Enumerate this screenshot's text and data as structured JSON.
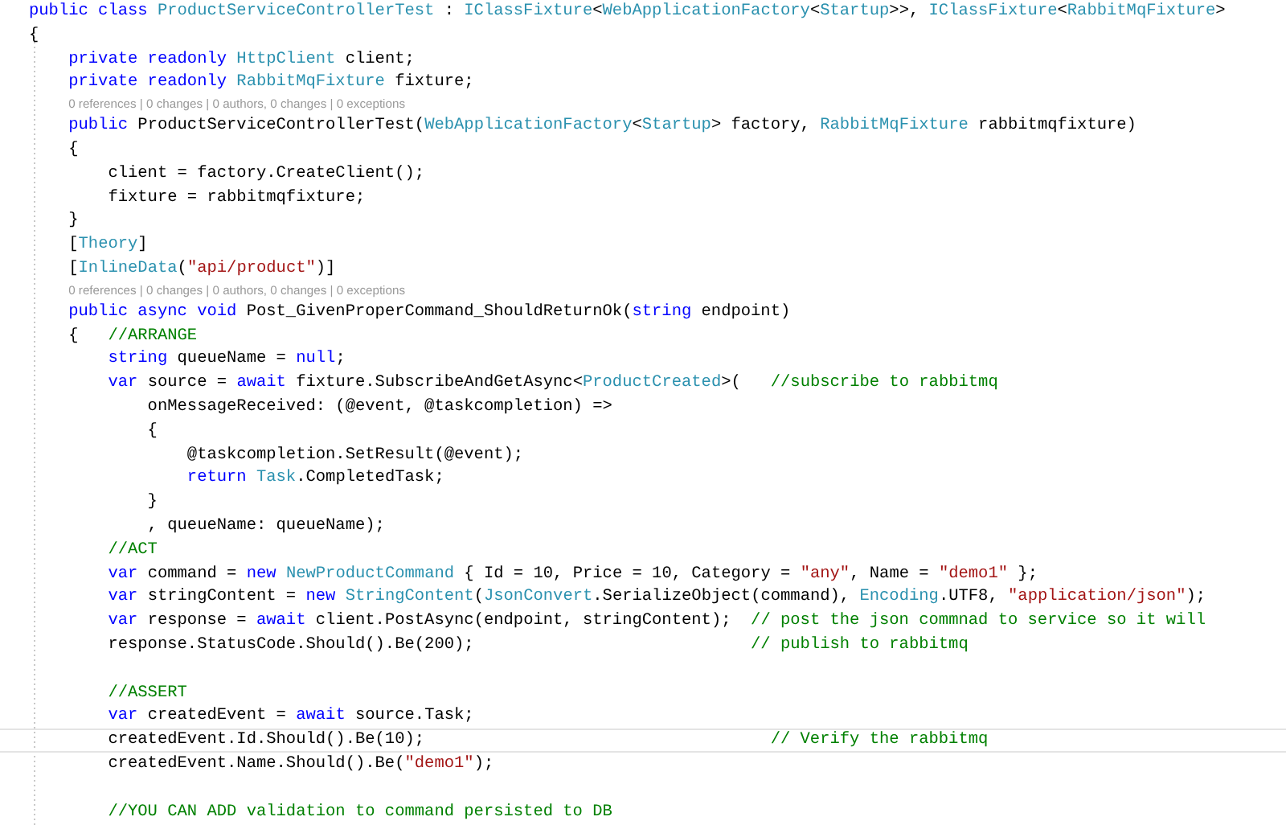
{
  "editor": {
    "lines": [
      {
        "kind": "code",
        "current": false,
        "tokens": [
          {
            "kind": "keyword",
            "text": "public class "
          },
          {
            "kind": "type",
            "text": "ProductServiceControllerTest"
          },
          {
            "kind": "plain",
            "text": " : "
          },
          {
            "kind": "type",
            "text": "IClassFixture"
          },
          {
            "kind": "plain",
            "text": "<"
          },
          {
            "kind": "type",
            "text": "WebApplicationFactory"
          },
          {
            "kind": "plain",
            "text": "<"
          },
          {
            "kind": "type",
            "text": "Startup"
          },
          {
            "kind": "plain",
            "text": ">>, "
          },
          {
            "kind": "type",
            "text": "IClassFixture"
          },
          {
            "kind": "plain",
            "text": "<"
          },
          {
            "kind": "type",
            "text": "RabbitMqFixture"
          },
          {
            "kind": "plain",
            "text": ">"
          }
        ]
      },
      {
        "kind": "code",
        "current": false,
        "tokens": [
          {
            "kind": "plain",
            "text": "{"
          }
        ]
      },
      {
        "kind": "code",
        "current": false,
        "tokens": [
          {
            "kind": "keyword",
            "text": "    private readonly "
          },
          {
            "kind": "type",
            "text": "HttpClient"
          },
          {
            "kind": "plain",
            "text": " client;"
          }
        ]
      },
      {
        "kind": "code",
        "current": false,
        "tokens": [
          {
            "kind": "keyword",
            "text": "    private readonly "
          },
          {
            "kind": "type",
            "text": "RabbitMqFixture"
          },
          {
            "kind": "plain",
            "text": " fixture;"
          }
        ]
      },
      {
        "kind": "codelens",
        "text": "0 references | 0 changes | 0 authors, 0 changes | 0 exceptions"
      },
      {
        "kind": "code",
        "current": false,
        "tokens": [
          {
            "kind": "keyword",
            "text": "    public "
          },
          {
            "kind": "plain",
            "text": "ProductServiceControllerTest("
          },
          {
            "kind": "type",
            "text": "WebApplicationFactory"
          },
          {
            "kind": "plain",
            "text": "<"
          },
          {
            "kind": "type",
            "text": "Startup"
          },
          {
            "kind": "plain",
            "text": "> factory, "
          },
          {
            "kind": "type",
            "text": "RabbitMqFixture"
          },
          {
            "kind": "plain",
            "text": " rabbitmqfixture)"
          }
        ]
      },
      {
        "kind": "code",
        "current": false,
        "tokens": [
          {
            "kind": "plain",
            "text": "    {"
          }
        ]
      },
      {
        "kind": "code",
        "current": false,
        "tokens": [
          {
            "kind": "plain",
            "text": "        client = factory.CreateClient();"
          }
        ]
      },
      {
        "kind": "code",
        "current": false,
        "tokens": [
          {
            "kind": "plain",
            "text": "        fixture = rabbitmqfixture;"
          }
        ]
      },
      {
        "kind": "code",
        "current": false,
        "tokens": [
          {
            "kind": "plain",
            "text": "    }"
          }
        ]
      },
      {
        "kind": "code",
        "current": false,
        "tokens": [
          {
            "kind": "plain",
            "text": "    ["
          },
          {
            "kind": "type",
            "text": "Theory"
          },
          {
            "kind": "plain",
            "text": "]"
          }
        ]
      },
      {
        "kind": "code",
        "current": false,
        "tokens": [
          {
            "kind": "plain",
            "text": "    ["
          },
          {
            "kind": "type",
            "text": "InlineData"
          },
          {
            "kind": "plain",
            "text": "("
          },
          {
            "kind": "string",
            "text": "\"api/product\""
          },
          {
            "kind": "plain",
            "text": ")]"
          }
        ]
      },
      {
        "kind": "codelens",
        "text": "0 references | 0 changes | 0 authors, 0 changes | 0 exceptions"
      },
      {
        "kind": "code",
        "current": false,
        "tokens": [
          {
            "kind": "keyword",
            "text": "    public async void "
          },
          {
            "kind": "plain",
            "text": "Post_GivenProperCommand_ShouldReturnOk("
          },
          {
            "kind": "keyword",
            "text": "string"
          },
          {
            "kind": "plain",
            "text": " endpoint)"
          }
        ]
      },
      {
        "kind": "code",
        "current": false,
        "tokens": [
          {
            "kind": "plain",
            "text": "    {   "
          },
          {
            "kind": "comment",
            "text": "//ARRANGE"
          }
        ]
      },
      {
        "kind": "code",
        "current": false,
        "tokens": [
          {
            "kind": "keyword",
            "text": "        string"
          },
          {
            "kind": "plain",
            "text": " queueName = "
          },
          {
            "kind": "keyword",
            "text": "null"
          },
          {
            "kind": "plain",
            "text": ";"
          }
        ]
      },
      {
        "kind": "code",
        "current": false,
        "tokens": [
          {
            "kind": "keyword",
            "text": "        var"
          },
          {
            "kind": "plain",
            "text": " source = "
          },
          {
            "kind": "keyword",
            "text": "await"
          },
          {
            "kind": "plain",
            "text": " fixture.SubscribeAndGetAsync<"
          },
          {
            "kind": "type",
            "text": "ProductCreated"
          },
          {
            "kind": "plain",
            "text": ">(   "
          },
          {
            "kind": "comment",
            "text": "//subscribe to rabbitmq"
          }
        ]
      },
      {
        "kind": "code",
        "current": false,
        "tokens": [
          {
            "kind": "plain",
            "text": "            onMessageReceived: (@event, @taskcompletion) =>"
          }
        ]
      },
      {
        "kind": "code",
        "current": false,
        "tokens": [
          {
            "kind": "plain",
            "text": "            {"
          }
        ]
      },
      {
        "kind": "code",
        "current": false,
        "tokens": [
          {
            "kind": "plain",
            "text": "                @taskcompletion.SetResult(@event);"
          }
        ]
      },
      {
        "kind": "code",
        "current": false,
        "tokens": [
          {
            "kind": "keyword",
            "text": "                return "
          },
          {
            "kind": "type",
            "text": "Task"
          },
          {
            "kind": "plain",
            "text": ".CompletedTask;"
          }
        ]
      },
      {
        "kind": "code",
        "current": false,
        "tokens": [
          {
            "kind": "plain",
            "text": "            }"
          }
        ]
      },
      {
        "kind": "code",
        "current": false,
        "tokens": [
          {
            "kind": "plain",
            "text": "            , queueName: queueName);"
          }
        ]
      },
      {
        "kind": "code",
        "current": false,
        "tokens": [
          {
            "kind": "comment",
            "text": "        //ACT"
          }
        ]
      },
      {
        "kind": "code",
        "current": false,
        "tokens": [
          {
            "kind": "keyword",
            "text": "        var"
          },
          {
            "kind": "plain",
            "text": " command = "
          },
          {
            "kind": "keyword",
            "text": "new "
          },
          {
            "kind": "type",
            "text": "NewProductCommand"
          },
          {
            "kind": "plain",
            "text": " { Id = 10, Price = 10, Category = "
          },
          {
            "kind": "string",
            "text": "\"any\""
          },
          {
            "kind": "plain",
            "text": ", Name = "
          },
          {
            "kind": "string",
            "text": "\"demo1\""
          },
          {
            "kind": "plain",
            "text": " };"
          }
        ]
      },
      {
        "kind": "code",
        "current": false,
        "tokens": [
          {
            "kind": "keyword",
            "text": "        var"
          },
          {
            "kind": "plain",
            "text": " stringContent = "
          },
          {
            "kind": "keyword",
            "text": "new "
          },
          {
            "kind": "type",
            "text": "StringContent"
          },
          {
            "kind": "plain",
            "text": "("
          },
          {
            "kind": "type",
            "text": "JsonConvert"
          },
          {
            "kind": "plain",
            "text": ".SerializeObject(command), "
          },
          {
            "kind": "type",
            "text": "Encoding"
          },
          {
            "kind": "plain",
            "text": ".UTF8, "
          },
          {
            "kind": "string",
            "text": "\"application/json\""
          },
          {
            "kind": "plain",
            "text": ");"
          }
        ]
      },
      {
        "kind": "code",
        "current": false,
        "tokens": [
          {
            "kind": "keyword",
            "text": "        var"
          },
          {
            "kind": "plain",
            "text": " response = "
          },
          {
            "kind": "keyword",
            "text": "await"
          },
          {
            "kind": "plain",
            "text": " client.PostAsync(endpoint, stringContent);  "
          },
          {
            "kind": "comment",
            "text": "// post the json commnad to service so it will"
          }
        ]
      },
      {
        "kind": "code",
        "current": false,
        "tokens": [
          {
            "kind": "plain",
            "text": "        response.StatusCode.Should().Be(200);                            "
          },
          {
            "kind": "comment",
            "text": "// publish to rabbitmq"
          }
        ]
      },
      {
        "kind": "blank"
      },
      {
        "kind": "code",
        "current": false,
        "tokens": [
          {
            "kind": "comment",
            "text": "        //ASSERT"
          }
        ]
      },
      {
        "kind": "code",
        "current": false,
        "tokens": [
          {
            "kind": "keyword",
            "text": "        var"
          },
          {
            "kind": "plain",
            "text": " createdEvent = "
          },
          {
            "kind": "keyword",
            "text": "await"
          },
          {
            "kind": "plain",
            "text": " source.Task;"
          }
        ]
      },
      {
        "kind": "code",
        "current": true,
        "tokens": [
          {
            "kind": "plain",
            "text": "        createdEvent.Id.Should().Be(10);                                   "
          },
          {
            "kind": "comment",
            "text": "// Verify the rabbitmq"
          }
        ]
      },
      {
        "kind": "code",
        "current": false,
        "tokens": [
          {
            "kind": "plain",
            "text": "        createdEvent.Name.Should().Be("
          },
          {
            "kind": "string",
            "text": "\"demo1\""
          },
          {
            "kind": "plain",
            "text": ");"
          }
        ]
      },
      {
        "kind": "blank"
      },
      {
        "kind": "code",
        "current": false,
        "tokens": [
          {
            "kind": "comment",
            "text": "        //YOU CAN ADD validation to command persisted to DB"
          }
        ]
      }
    ]
  }
}
